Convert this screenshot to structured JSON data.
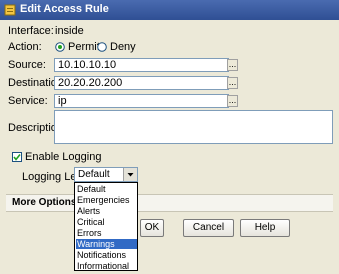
{
  "window": {
    "title": "Edit Access Rule"
  },
  "form": {
    "interface_label": "Interface:",
    "interface_value": "inside",
    "action_label": "Action:",
    "permit_label": "Permit",
    "deny_label": "Deny",
    "action_selected": "Permit",
    "source_label": "Source:",
    "source_value": "10.10.10.10",
    "destination_label": "Destination",
    "destination_value": "20.20.20.200",
    "service_label": "Service:",
    "service_value": "ip",
    "browse_label": "...",
    "description_label": "Description:",
    "description_value": "",
    "enable_logging_label": "Enable Logging",
    "enable_logging_checked": true,
    "logging_level_label": "Logging Level:",
    "logging_level_value": "Default"
  },
  "dropdown": {
    "options": [
      "Default",
      "Emergencies",
      "Alerts",
      "Critical",
      "Errors",
      "Warnings",
      "Notifications",
      "Informational"
    ],
    "highlighted": "Warnings"
  },
  "more_options": {
    "label": "More Options"
  },
  "buttons": {
    "ok": "OK",
    "cancel": "Cancel",
    "help": "Help"
  },
  "colors": {
    "titlebar": "#2f4f94",
    "highlight": "#316ac5",
    "dialog_bg": "#ece9d8"
  }
}
